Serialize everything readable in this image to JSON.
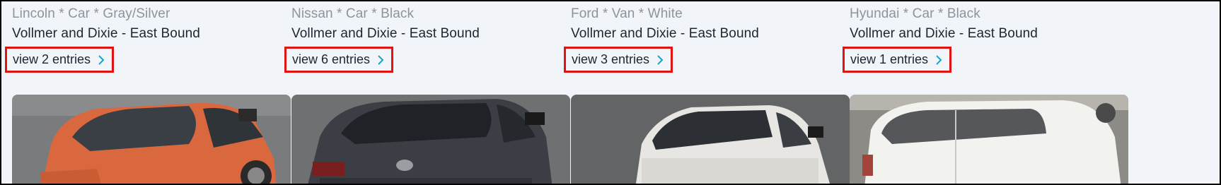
{
  "cards": [
    {
      "vehicle": "Lincoln * Car * Gray/Silver",
      "location": "Vollmer and Dixie - East Bound",
      "entries_label": "view 2 entries",
      "vehicle_color": "#d9683e",
      "icon": "chevron-right-icon"
    },
    {
      "vehicle": "Nissan * Car * Black",
      "location": "Vollmer and Dixie - East Bound",
      "entries_label": "view 6 entries",
      "vehicle_color": "#3b3e44",
      "icon": "chevron-right-icon"
    },
    {
      "vehicle": "Ford * Van * White",
      "location": "Vollmer and Dixie - East Bound",
      "entries_label": "view 3 entries",
      "vehicle_color": "#e7e6e2",
      "icon": "chevron-right-icon"
    },
    {
      "vehicle": "Hyundai * Car * Black",
      "location": "Vollmer and Dixie - East Bound",
      "entries_label": "view 1 entries",
      "vehicle_color": "#f2f2ef",
      "icon": "chevron-right-icon"
    }
  ],
  "colors": {
    "background": "#f1f4f9",
    "highlight": "#e01313",
    "chevron": "#1aa3c9",
    "meta_text": "#8e949b",
    "body_text": "#1e2530"
  }
}
